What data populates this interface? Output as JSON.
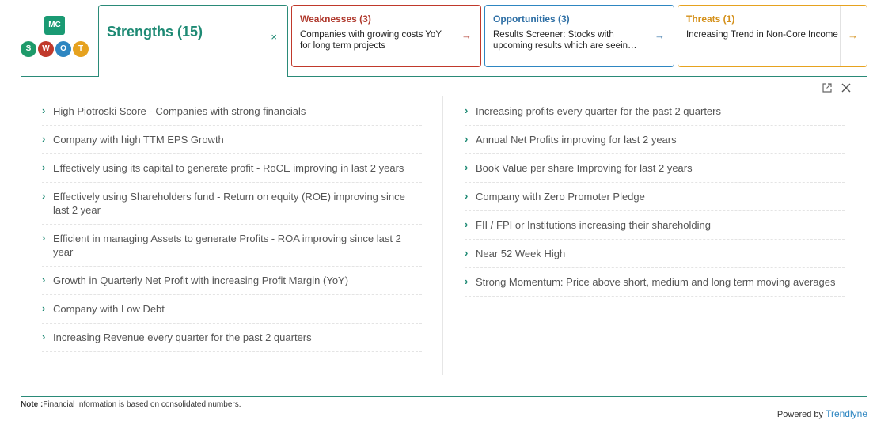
{
  "logo": {
    "top_text": "MC",
    "letters": [
      "S",
      "W",
      "O",
      "T"
    ]
  },
  "tabs": {
    "strengths": {
      "title": "Strengths (15)",
      "close": "×"
    },
    "weaknesses": {
      "title": "Weaknesses (3)",
      "desc": "Companies with growing costs YoY for long term projects",
      "arrow": "→"
    },
    "opportunities": {
      "title": "Opportunities (3)",
      "desc": "Results Screener: Stocks with upcoming results which are seein…",
      "arrow": "→"
    },
    "threats": {
      "title": "Threats (1)",
      "desc": "Increasing Trend in Non-Core Income",
      "arrow": "→"
    }
  },
  "panel": {
    "left_items": [
      "High Piotroski Score - Companies with strong financials",
      "Company with high TTM EPS Growth",
      "Effectively using its capital to generate profit - RoCE improving in last 2 years",
      "Effectively using Shareholders fund - Return on equity (ROE) improving since last 2 year",
      "Efficient in managing Assets to generate Profits - ROA improving since last 2 year",
      "Growth in Quarterly Net Profit with increasing Profit Margin (YoY)",
      "Company with Low Debt",
      "Increasing Revenue every quarter for the past 2 quarters"
    ],
    "right_items": [
      "Increasing profits every quarter for the past 2 quarters",
      "Annual Net Profits improving for last 2 years",
      "Book Value per share Improving for last 2 years",
      "Company with Zero Promoter Pledge",
      "FII / FPI or Institutions increasing their shareholding",
      "Near 52 Week High",
      "Strong Momentum: Price above short, medium and long term moving averages"
    ],
    "chevron": "›"
  },
  "footer": {
    "note_label": "Note :",
    "note_text": "Financial Information is based on consolidated numbers.",
    "powered_by": "Powered by ",
    "brand": "Trendlyne"
  },
  "colors": {
    "strength": "#1e8a74",
    "weakness": "#c0392b",
    "opportunity": "#2e86c1",
    "threat": "#e6a21f"
  },
  "icons": [
    "external-link-icon",
    "close-icon",
    "chevron-right-icon",
    "arrow-right-icon"
  ]
}
